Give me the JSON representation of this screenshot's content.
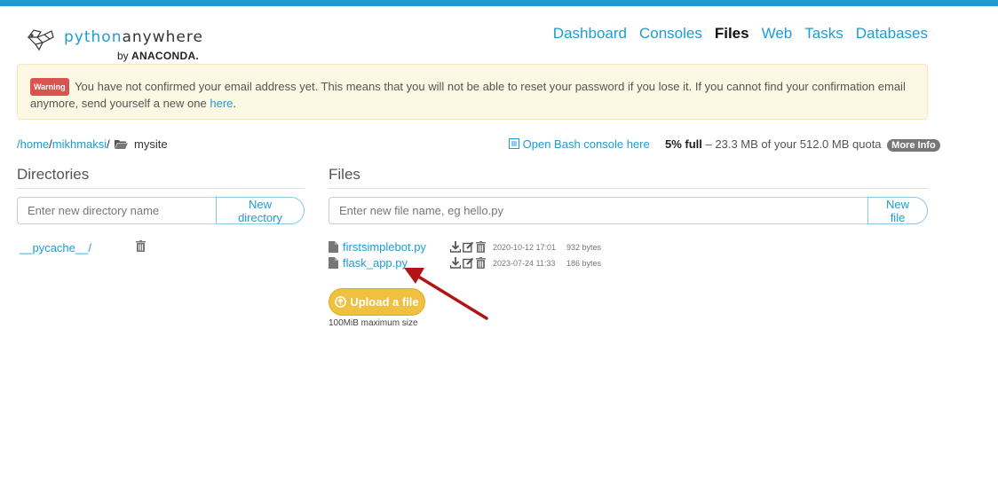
{
  "brand": {
    "name_part1": "python",
    "name_part2": "anywhere",
    "by": "by",
    "company": "ANACONDA.",
    "accent_color": "#1d9cd3"
  },
  "nav": {
    "items": [
      "Dashboard",
      "Consoles",
      "Files",
      "Web",
      "Tasks",
      "Databases"
    ],
    "active": "Files"
  },
  "alert": {
    "badge": "Warning",
    "message": "You have not confirmed your email address yet. This means that you will not be able to reset your password if you lose it. If you cannot find your confirmation email anymore, send yourself a new one",
    "link_text": "here",
    "suffix": "."
  },
  "breadcrumb": {
    "root": "/home",
    "user": "mikhmaksi",
    "sep": "/",
    "current": "mysite"
  },
  "bash_link": "Open Bash console here",
  "quota": {
    "percent_label": "5% full",
    "dash": " – ",
    "detail": "23.3 MB of your 512.0 MB quota",
    "more_info": "More Info",
    "fraction_used": 0.05
  },
  "directories": {
    "title": "Directories",
    "input_placeholder": "Enter new directory name",
    "button_label": "New directory",
    "items": [
      {
        "name": "__pycache__/"
      }
    ]
  },
  "files": {
    "title": "Files",
    "input_placeholder": "Enter new file name, eg hello.py",
    "button_label": "New file",
    "items": [
      {
        "name": "firstsimplebot.py",
        "modified": "2020-10-12 17:01",
        "size": "932 bytes"
      },
      {
        "name": "flask_app.py",
        "modified": "2023-07-24 11:33",
        "size": "186 bytes"
      }
    ],
    "upload_label": "Upload a file",
    "upload_note": "100MiB maximum size"
  },
  "colors": {
    "topbar": "#1d9cd3",
    "upload": "#f0c040",
    "arrow": "#b01414",
    "warning_badge": "#d9534f"
  }
}
